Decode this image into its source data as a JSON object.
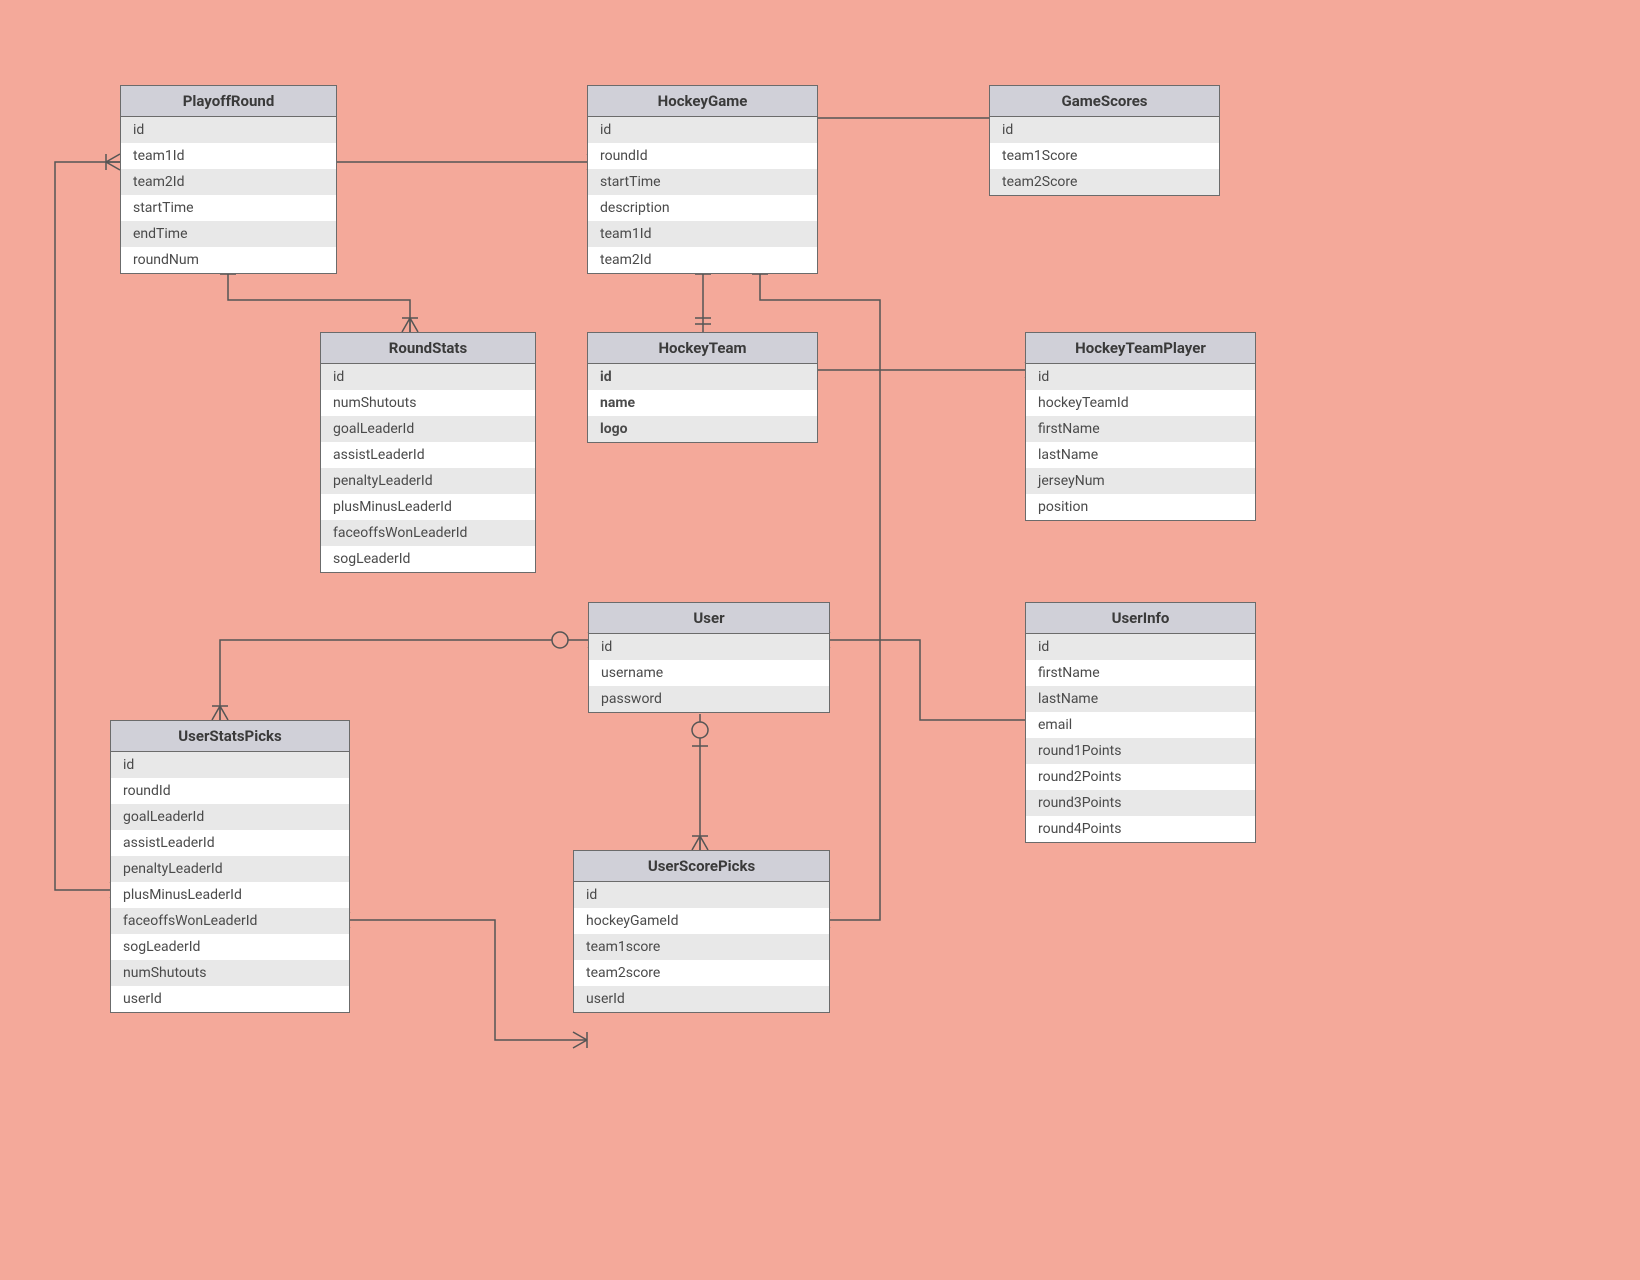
{
  "entities": {
    "playoffRound": {
      "title": "PlayoffRound",
      "fields": [
        "id",
        "team1Id",
        "team2Id",
        "startTime",
        "endTime",
        "roundNum"
      ]
    },
    "hockeyGame": {
      "title": "HockeyGame",
      "fields": [
        "id",
        "roundId",
        "startTime",
        "description",
        "team1Id",
        "team2Id"
      ]
    },
    "gameScores": {
      "title": "GameScores",
      "fields": [
        "id",
        "team1Score",
        "team2Score"
      ]
    },
    "roundStats": {
      "title": "RoundStats",
      "fields": [
        "id",
        "numShutouts",
        "goalLeaderId",
        "assistLeaderId",
        "penaltyLeaderId",
        "plusMinusLeaderId",
        "faceoffsWonLeaderId",
        "sogLeaderId"
      ]
    },
    "hockeyTeam": {
      "title": "HockeyTeam",
      "fields": [
        "id",
        "name",
        "logo"
      ]
    },
    "hockeyTeamPlayer": {
      "title": "HockeyTeamPlayer",
      "fields": [
        "id",
        "hockeyTeamId",
        "firstName",
        "lastName",
        "jerseyNum",
        "position"
      ]
    },
    "user": {
      "title": "User",
      "fields": [
        "id",
        "username",
        "password"
      ]
    },
    "userInfo": {
      "title": "UserInfo",
      "fields": [
        "id",
        "firstName",
        "lastName",
        "email",
        "round1Points",
        "round2Points",
        "round3Points",
        "round4Points"
      ]
    },
    "userStatsPicks": {
      "title": "UserStatsPicks",
      "fields": [
        "id",
        "roundId",
        "goalLeaderId",
        "assistLeaderId",
        "penaltyLeaderId",
        "plusMinusLeaderId",
        "faceoffsWonLeaderId",
        "sogLeaderId",
        "numShutouts",
        "userId"
      ]
    },
    "userScorePicks": {
      "title": "UserScorePicks",
      "fields": [
        "id",
        "hockeyGameId",
        "team1score",
        "team2score",
        "userId"
      ]
    }
  }
}
